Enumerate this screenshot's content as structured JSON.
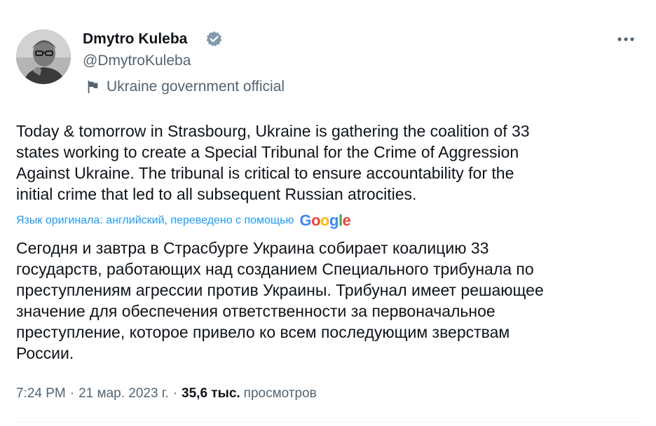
{
  "author": {
    "display_name": "Dmytro Kuleba",
    "handle": "@DmytroKuleba",
    "label": "Ukraine government official",
    "avatar_icon": "person-photo",
    "verified_icon": "verified-badge-icon",
    "verified_color": "#829aab"
  },
  "tweet": {
    "text_lines": [
      "Today & tomorrow in Strasbourg, Ukraine is gathering the coalition of 33",
      "states working to create a Special Tribunal for the Crime of Aggression",
      "Against Ukraine. The tribunal is critical to ensure accountability for the",
      "initial crime that led to all subsequent Russian atrocities."
    ],
    "translation_note": "Язык оригинала: английский, переведено с помощью",
    "translation_provider": "Google",
    "translated_lines": [
      "Сегодня и завтра в Страсбурге Украина собирает коалицию 33",
      "государств, работающих над созданием Специального трибунала по",
      "преступлениям агрессии против Украины. Трибунал имеет решающее",
      "значение для обеспечения ответственности за первоначальное",
      "преступление, которое привело ко всем последующим зверствам",
      "России."
    ]
  },
  "meta": {
    "time": "7:24 PM",
    "separator": "·",
    "date": "21 мар. 2023 г.",
    "views_count": "35,6 тыс.",
    "views_label": "просмотров"
  },
  "colors": {
    "text": "#0f1419",
    "secondary": "#536471",
    "link": "#1d9bf0"
  },
  "icons": {
    "more": "more-dots-icon",
    "flag": "flag-icon"
  }
}
